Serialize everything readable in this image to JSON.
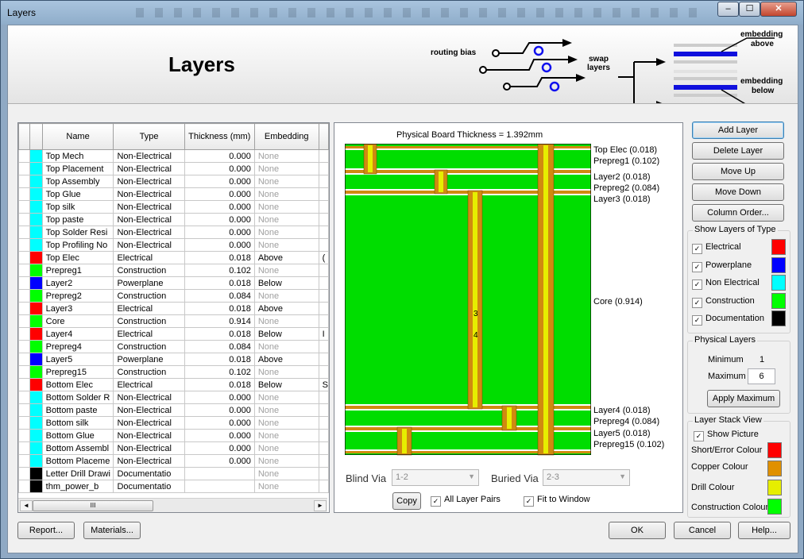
{
  "window": {
    "title": "Layers",
    "minimize": "‒",
    "maximize": "☐",
    "close": "✕"
  },
  "banner": {
    "heading": "Layers",
    "routing_bias": "routing bias",
    "swap_layers_1": "swap",
    "swap_layers_2": "layers",
    "embedding_above_1": "embedding",
    "embedding_above_2": "above",
    "embedding_below_1": "embedding",
    "embedding_below_2": "below"
  },
  "grid": {
    "headers": [
      "Name",
      "Type",
      "Thickness (mm)",
      "Embedding"
    ],
    "rows": [
      {
        "color": "#00ffff",
        "name": "Top Mech",
        "type": "Non-Electrical",
        "thickness": "0.000",
        "embedding": "None",
        "extra": ""
      },
      {
        "color": "#00ffff",
        "name": "Top Placement",
        "type": "Non-Electrical",
        "thickness": "0.000",
        "embedding": "None",
        "extra": ""
      },
      {
        "color": "#00ffff",
        "name": "Top Assembly",
        "type": "Non-Electrical",
        "thickness": "0.000",
        "embedding": "None",
        "extra": ""
      },
      {
        "color": "#00ffff",
        "name": "Top Glue",
        "type": "Non-Electrical",
        "thickness": "0.000",
        "embedding": "None",
        "extra": ""
      },
      {
        "color": "#00ffff",
        "name": "Top silk",
        "type": "Non-Electrical",
        "thickness": "0.000",
        "embedding": "None",
        "extra": ""
      },
      {
        "color": "#00ffff",
        "name": "Top paste",
        "type": "Non-Electrical",
        "thickness": "0.000",
        "embedding": "None",
        "extra": ""
      },
      {
        "color": "#00ffff",
        "name": "Top Solder Resi",
        "type": "Non-Electrical",
        "thickness": "0.000",
        "embedding": "None",
        "extra": ""
      },
      {
        "color": "#00ffff",
        "name": "Top Profiling No",
        "type": "Non-Electrical",
        "thickness": "0.000",
        "embedding": "None",
        "extra": ""
      },
      {
        "color": "#ff0000",
        "name": "Top Elec",
        "type": "Electrical",
        "thickness": "0.018",
        "embedding": "Above",
        "extra": "("
      },
      {
        "color": "#00ff00",
        "name": "Prepreg1",
        "type": "Construction",
        "thickness": "0.102",
        "embedding": "None",
        "extra": ""
      },
      {
        "color": "#0000ff",
        "name": "Layer2",
        "type": "Powerplane",
        "thickness": "0.018",
        "embedding": "Below",
        "extra": ""
      },
      {
        "color": "#00ff00",
        "name": "Prepreg2",
        "type": "Construction",
        "thickness": "0.084",
        "embedding": "None",
        "extra": ""
      },
      {
        "color": "#ff0000",
        "name": "Layer3",
        "type": "Electrical",
        "thickness": "0.018",
        "embedding": "Above",
        "extra": ""
      },
      {
        "color": "#00ff00",
        "name": "Core",
        "type": "Construction",
        "thickness": "0.914",
        "embedding": "None",
        "extra": ""
      },
      {
        "color": "#ff0000",
        "name": "Layer4",
        "type": "Electrical",
        "thickness": "0.018",
        "embedding": "Below",
        "extra": "I"
      },
      {
        "color": "#00ff00",
        "name": "Prepreg4",
        "type": "Construction",
        "thickness": "0.084",
        "embedding": "None",
        "extra": ""
      },
      {
        "color": "#0000ff",
        "name": "Layer5",
        "type": "Powerplane",
        "thickness": "0.018",
        "embedding": "Above",
        "extra": ""
      },
      {
        "color": "#00ff00",
        "name": "Prepreg15",
        "type": "Construction",
        "thickness": "0.102",
        "embedding": "None",
        "extra": ""
      },
      {
        "color": "#ff0000",
        "name": "Bottom Elec",
        "type": "Electrical",
        "thickness": "0.018",
        "embedding": "Below",
        "extra": "S"
      },
      {
        "color": "#00ffff",
        "name": "Bottom Solder R",
        "type": "Non-Electrical",
        "thickness": "0.000",
        "embedding": "None",
        "extra": ""
      },
      {
        "color": "#00ffff",
        "name": "Bottom paste",
        "type": "Non-Electrical",
        "thickness": "0.000",
        "embedding": "None",
        "extra": ""
      },
      {
        "color": "#00ffff",
        "name": "Bottom silk",
        "type": "Non-Electrical",
        "thickness": "0.000",
        "embedding": "None",
        "extra": ""
      },
      {
        "color": "#00ffff",
        "name": "Bottom Glue",
        "type": "Non-Electrical",
        "thickness": "0.000",
        "embedding": "None",
        "extra": ""
      },
      {
        "color": "#00ffff",
        "name": "Bottom Assembl",
        "type": "Non-Electrical",
        "thickness": "0.000",
        "embedding": "None",
        "extra": ""
      },
      {
        "color": "#00ffff",
        "name": "Bottom Placeme",
        "type": "Non-Electrical",
        "thickness": "0.000",
        "embedding": "None",
        "extra": ""
      },
      {
        "color": "#000000",
        "name": "Letter Drill Drawi",
        "type": "Documentatio",
        "thickness": "",
        "embedding": "None",
        "extra": ""
      },
      {
        "color": "#000000",
        "name": "thm_power_b",
        "type": "Documentatio",
        "thickness": "",
        "embedding": "None",
        "extra": ""
      }
    ],
    "scroll_thumb": "III",
    "scroll_left": "◄",
    "scroll_right": "►"
  },
  "board": {
    "title": "Physical Board Thickness = 1.392mm",
    "labels": {
      "top_elec": "Top Elec (0.018)",
      "prepreg1": "Prepreg1 (0.102)",
      "layer2": "Layer2 (0.018)",
      "prepreg2": "Prepreg2 (0.084)",
      "layer3": "Layer3 (0.018)",
      "core": "Core (0.914)",
      "layer4": "Layer4 (0.018)",
      "prepreg4": "Prepreg4 (0.084)",
      "layer5": "Layer5 (0.018)",
      "prepreg15": "Prepreg15 (0.102)"
    },
    "via_label_top": "3",
    "via_label_bottom": "4",
    "blind_via_label": "Blind Via",
    "blind_via_value": "1-2",
    "buried_via_label": "Buried Via",
    "buried_via_value": "2-3",
    "copy_label": "Copy",
    "all_layer_pairs_label": "All Layer Pairs",
    "fit_to_window_label": "Fit to Window"
  },
  "actions": {
    "add_layer": "Add Layer",
    "delete_layer": "Delete Layer",
    "move_up": "Move Up",
    "move_down": "Move Down",
    "column_order": "Column Order..."
  },
  "show_layers": {
    "title": "Show Layers of Type",
    "items": [
      {
        "label": "Electrical",
        "color": "#ff0000"
      },
      {
        "label": "Powerplane",
        "color": "#0000ff"
      },
      {
        "label": "Non Electrical",
        "color": "#00ffff"
      },
      {
        "label": "Construction",
        "color": "#00ff00"
      },
      {
        "label": "Documentation",
        "color": "#000000"
      }
    ]
  },
  "physical_layers": {
    "title": "Physical Layers",
    "minimum_label": "Minimum",
    "minimum_value": "1",
    "maximum_label": "Maximum",
    "maximum_value": "6",
    "apply_label": "Apply Maximum"
  },
  "stack_view": {
    "title": "Layer Stack View",
    "show_picture": "Show Picture",
    "short_error": "Short/Error Colour",
    "copper": "Copper Colour",
    "drill": "Drill Colour",
    "construction": "Construction Colour",
    "colors": {
      "short_error": "#ff0000",
      "copper": "#e09000",
      "drill": "#e6ee00",
      "construction": "#00ff00"
    }
  },
  "footer": {
    "report": "Report...",
    "materials": "Materials...",
    "ok": "OK",
    "cancel": "Cancel",
    "help": "Help..."
  },
  "checkmark": "✓"
}
